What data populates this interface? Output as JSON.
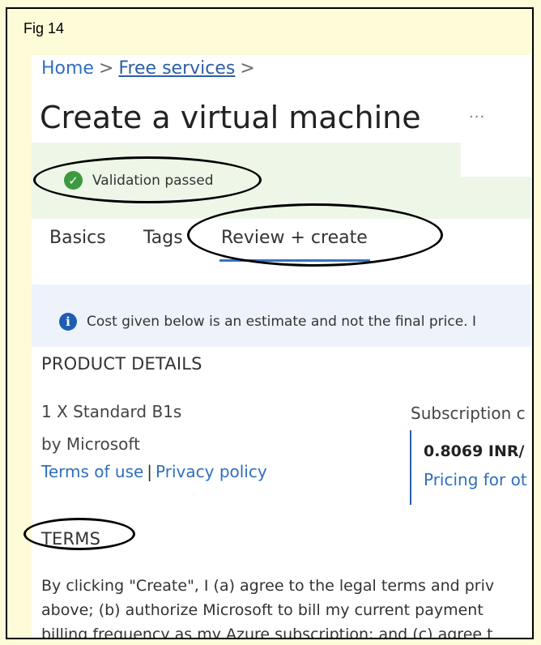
{
  "figure": {
    "label": "Fig 14"
  },
  "breadcrumb": {
    "home": "Home",
    "separator": ">",
    "free_services": "Free services"
  },
  "header": {
    "title": "Create a virtual machine",
    "more": "···"
  },
  "validation": {
    "text": "Validation passed",
    "status_color": "#3d9a3f"
  },
  "tabs": [
    {
      "label": "Basics"
    },
    {
      "label": "Tags"
    },
    {
      "label": "Review + create",
      "active": true
    }
  ],
  "info": {
    "text": "Cost given below is an estimate and not the final price. I"
  },
  "product_details": {
    "heading": "PRODUCT DETAILS",
    "name": "1 X Standard B1s",
    "vendor": "by Microsoft",
    "terms_link": "Terms of use",
    "link_separator": "|",
    "privacy_link": "Privacy policy",
    "subscription_label": "Subscription c",
    "price": "0.8069 INR/",
    "pricing_link": "Pricing for ot"
  },
  "terms": {
    "heading": "TERMS",
    "lines": [
      "By clicking \"Create\", I (a) agree to the legal terms and priv",
      "above; (b) authorize Microsoft to bill my current payment",
      "billing frequency as my Azure subscription; and (c) agree t"
    ]
  },
  "colors": {
    "link": "#2f6fbf",
    "accent_tab": "#3574c4",
    "info_icon": "#1f5db3",
    "background": "#fdfbd8"
  }
}
